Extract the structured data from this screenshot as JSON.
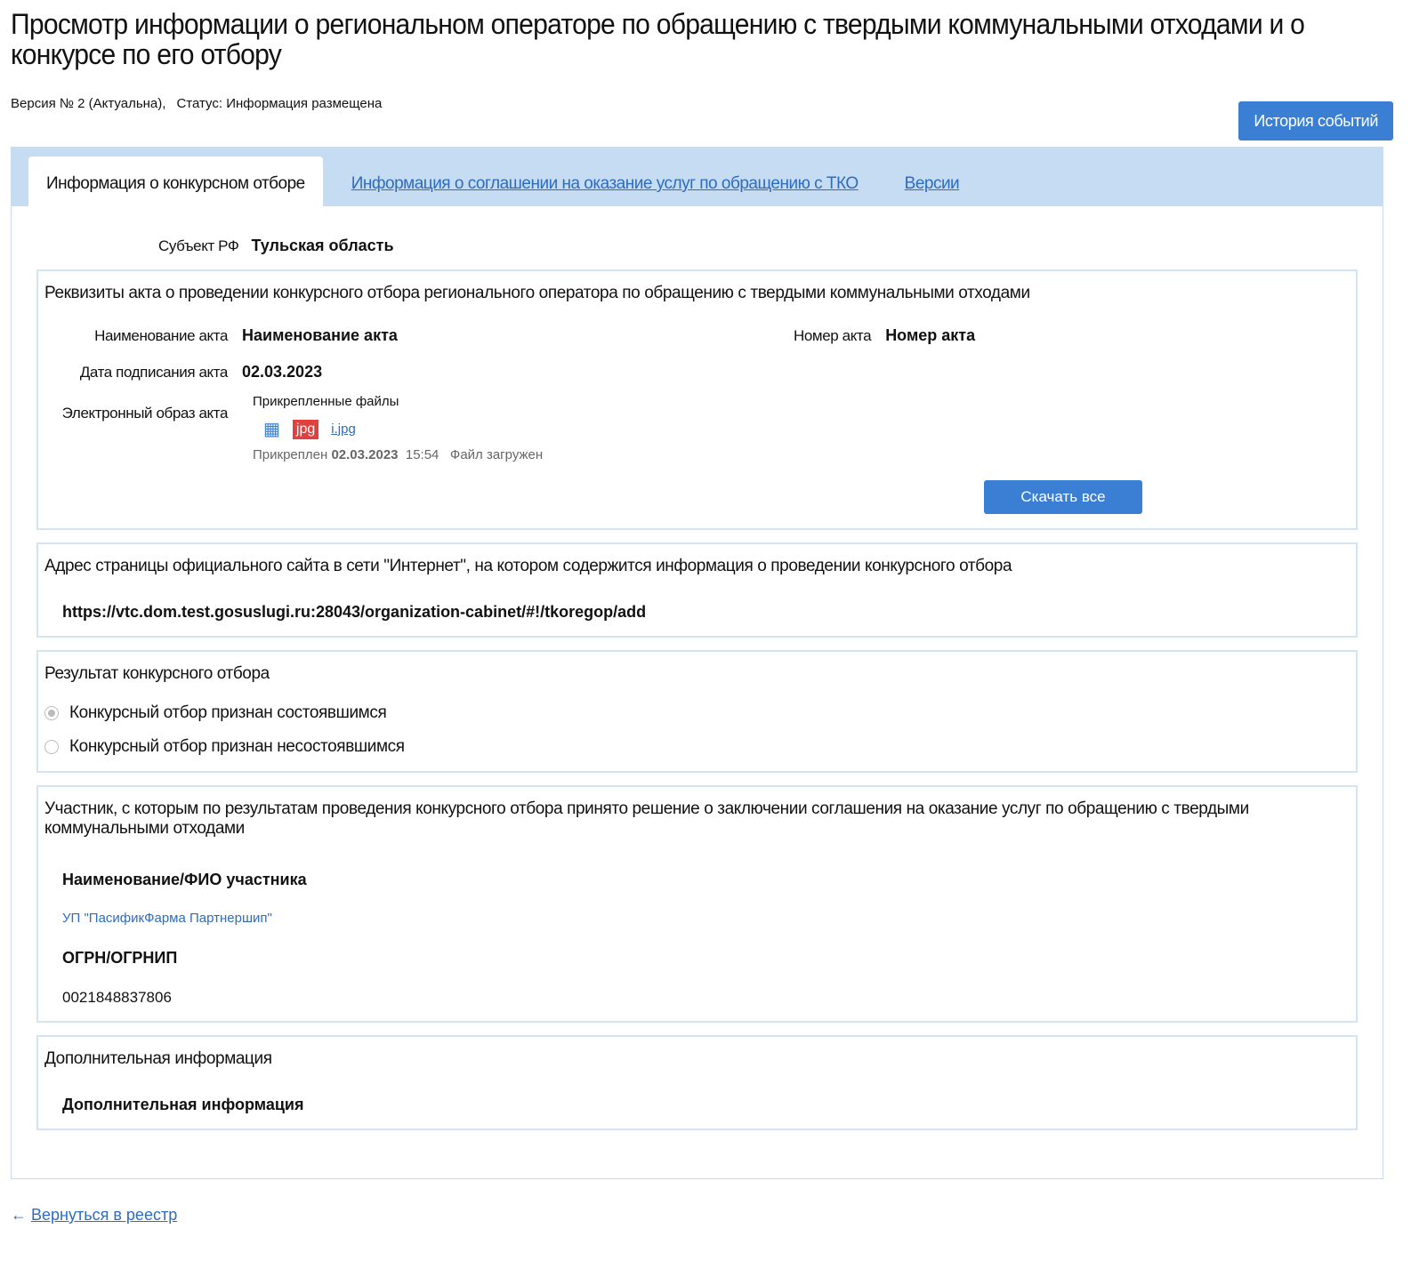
{
  "title": "Просмотр информации о региональном операторе по обращению с твердыми коммунальными отходами и о конкурсе по его отбору",
  "version": "Версия № 2 (Актуальна),",
  "status": "Статус: Информация размещена",
  "history_button": "История событий",
  "tabs": [
    "Информация о конкурсном отборе",
    "Информация о соглашении на оказание услуг по обращению с ТКО",
    "Версии"
  ],
  "subject": {
    "label": "Субъект РФ",
    "value": "Тульская область"
  },
  "act": {
    "title": "Реквизиты акта о проведении конкурсного отбора регионального оператора по обращению с твердыми коммунальными отходами",
    "name_label": "Наименование акта",
    "name_value": "Наименование акта",
    "number_label": "Номер акта",
    "number_value": "Номер акта",
    "date_label": "Дата подписания акта",
    "date_value": "02.03.2023",
    "image_label": "Электронный образ акта",
    "files_label": "Прикрепленные файлы",
    "file_type": "jpg",
    "file_name": "i.jpg",
    "attached_label": "Прикреплен",
    "attached_date": "02.03.2023",
    "attached_time": "15:54",
    "file_status": "Файл загружен",
    "download_all": "Скачать все"
  },
  "site": {
    "title": "Адрес страницы официального сайта в сети \"Интернет\", на котором содержится информация о проведении конкурсного отбора",
    "url": "https://vtc.dom.test.gosuslugi.ru:28043/organization-cabinet/#!/tkoregop/add"
  },
  "result": {
    "title": "Результат конкурсного отбора",
    "options": [
      "Конкурсный отбор признан состоявшимся",
      "Конкурсный отбор признан несостоявшимся"
    ],
    "selected": 0
  },
  "participant": {
    "title": "Участник, с которым по результатам проведения конкурсного отбора принято решение о заключении соглашения на оказание услуг по обращению с твердыми коммунальными отходами",
    "name_label": "Наименование/ФИО участника",
    "name_value": "УП \"ПасификФарма Партнершип\"",
    "ogrn_label": "ОГРН/ОГРНИП",
    "ogrn_value": "0021848837806"
  },
  "extra": {
    "title": "Дополнительная информация",
    "value": "Дополнительная информация"
  },
  "back_link": "Вернуться в реестр"
}
